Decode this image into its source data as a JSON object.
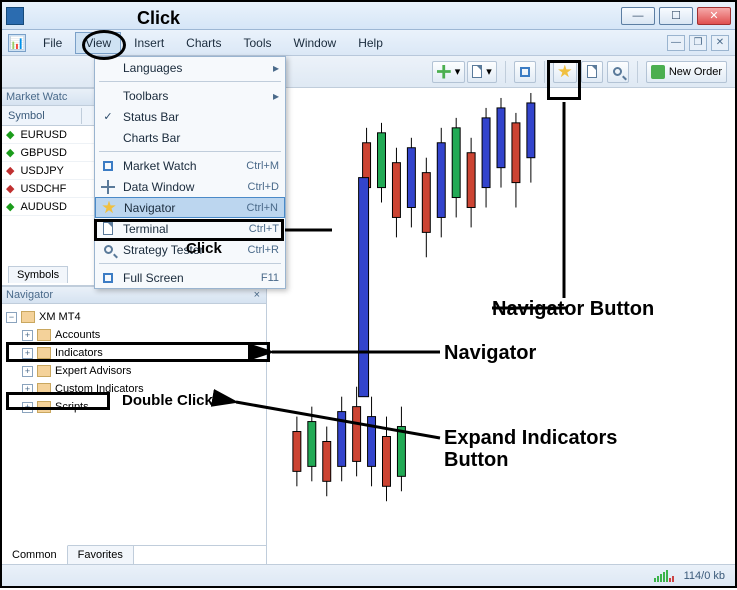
{
  "annotations": {
    "click_top": "Click",
    "click_menu": "Click",
    "double_click": "Double Click",
    "navigator_button": "Navigator Button",
    "navigator_label": "Navigator",
    "expand_label": "Expand Indicators\nButton"
  },
  "menubar": {
    "file": "File",
    "view": "View",
    "insert": "Insert",
    "charts": "Charts",
    "tools": "Tools",
    "window": "Window",
    "help": "Help"
  },
  "view_menu": {
    "languages": "Languages",
    "toolbars": "Toolbars",
    "status_bar": "Status Bar",
    "charts_bar": "Charts Bar",
    "market_watch": {
      "label": "Market Watch",
      "shortcut": "Ctrl+M"
    },
    "data_window": {
      "label": "Data Window",
      "shortcut": "Ctrl+D"
    },
    "navigator": {
      "label": "Navigator",
      "shortcut": "Ctrl+N"
    },
    "terminal": {
      "label": "Terminal",
      "shortcut": "Ctrl+T"
    },
    "strategy": {
      "label": "Strategy Tester",
      "shortcut": "Ctrl+R"
    },
    "fullscreen": {
      "label": "Full Screen",
      "shortcut": "F11"
    }
  },
  "toolbar": {
    "new_order": "New Order"
  },
  "market_watch": {
    "title": "Market Watc",
    "col_symbol": "Symbol",
    "rows": [
      {
        "dir": "up",
        "sym": "EURUSD"
      },
      {
        "dir": "up",
        "sym": "GBPUSD"
      },
      {
        "dir": "dn",
        "sym": "USDJPY"
      },
      {
        "dir": "dn",
        "sym": "USDCHF"
      },
      {
        "dir": "up",
        "sym": "AUDUSD"
      }
    ],
    "symbols_tab": "Symbols"
  },
  "navigator": {
    "title": "Navigator",
    "root": "XM MT4",
    "items": [
      "Accounts",
      "Indicators",
      "Expert Advisors",
      "Custom Indicators",
      "Scripts"
    ],
    "tabs": {
      "common": "Common",
      "favorites": "Favorites"
    }
  },
  "status": {
    "speed": "114/0 kb"
  }
}
